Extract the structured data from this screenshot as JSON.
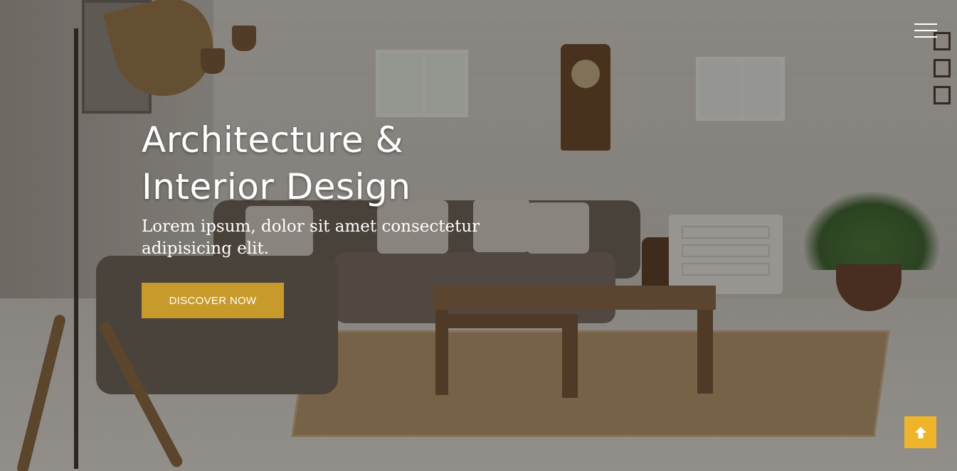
{
  "hero": {
    "title_line1": "Architecture &",
    "title_line2": "Interior Design",
    "subtitle": "Lorem ipsum, dolor sit amet consectetur adipisicing elit.",
    "cta_label": "DISCOVER NOW"
  },
  "header": {
    "menu_icon": "hamburger-menu-icon"
  },
  "back_to_top": {
    "icon": "arrow-up-icon"
  },
  "colors": {
    "accent": "#c79a2b",
    "back_to_top_bg": "#efb52a",
    "text": "#ffffff"
  }
}
